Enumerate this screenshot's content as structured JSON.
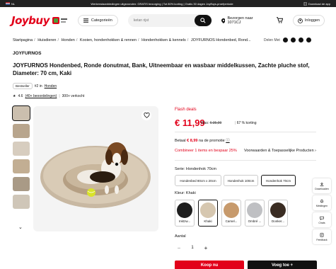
{
  "topbar": {
    "lang": "NL",
    "message": "Werkenstaanbiedingen uitgezonden: GRATIS bezorging | Tot 80% korting | Gratis 30 dagen Joyffuys-proefperiode",
    "download": "Download de app"
  },
  "header": {
    "logo": "Joybuy",
    "categories_label": "Categorieën",
    "search_placeholder": "ketan rijst",
    "location": "Bezorgen naar 1071CJ",
    "login": "Inloggen"
  },
  "breadcrumbs": [
    "Startpagina",
    "Huisdieren",
    "Honden",
    "Kooien, hondenhokken & rennen",
    "Hondenhokken & kennels",
    "JOYFURNOS Hondenbed, Rond..."
  ],
  "share_label": "Delen Met",
  "product": {
    "brand": "JOYFURNOS",
    "title": "JOYFURNOS Hondenbed, Ronde donutmat, Bank, Uitneembaar en wasbaar middelkussen, Zachte pluche stof, Diameter: 70 cm, Kaki",
    "bestseller_badge": "Bestseller",
    "rank_prefix": "#2 in",
    "rank_link": "Honden",
    "rating": "4.6",
    "reviews": "(40+ beoordelingen)",
    "sold": "300+ verkocht"
  },
  "pricing": {
    "flash": "Flash deals",
    "price": "€ 11,99",
    "was_label": "Was:",
    "was_price": "€ 35,99",
    "discount": "67 % korting",
    "promo_prefix": "Betaal",
    "promo_amount": "€ 8,99",
    "promo_suffix": "na de promotie",
    "combi_left": "Combineer 1 items en bespaar 25%",
    "combi_right": "Voorwaarden & Toepasselijke Producten"
  },
  "options": {
    "series_label": "Serie:",
    "series_value": "Hondenhok 70cm",
    "series": [
      "Hondenbed 80cm x 20cm",
      "Hondenhok 100cm",
      "Hondenhok 70cm"
    ],
    "color_label": "Kleur:",
    "color_value": "Khaki",
    "colors": [
      "Inktzw...",
      "Khaki",
      "Camel...",
      "Ombré ...",
      "Donker..."
    ],
    "qty_label": "Aantal",
    "qty": "1"
  },
  "buttons": {
    "buy": "Koop nu",
    "view": "Voeg toe +"
  },
  "side_toolbar": [
    "Downloaden",
    "Meldingen",
    "Chats",
    "Feedback"
  ],
  "colors": {
    "brand_red": "#e2001a"
  }
}
